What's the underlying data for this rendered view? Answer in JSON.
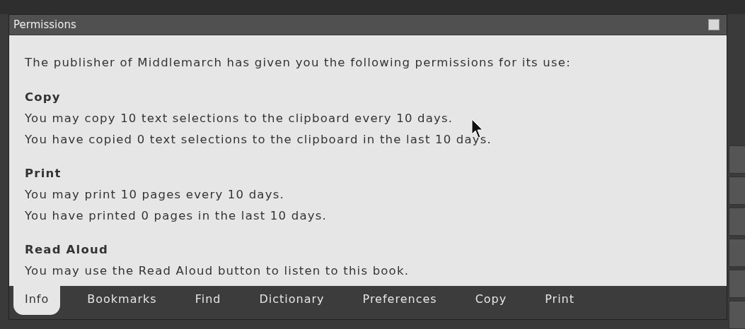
{
  "window": {
    "title": "Permissions"
  },
  "intro": "The publisher of Middlemarch has given you the following permissions for its use:",
  "sections": [
    {
      "heading": "Copy",
      "lines": [
        "You may copy 10 text selections to the clipboard every 10 days.",
        "You have copied 0 text selections to the clipboard in the last 10 days."
      ]
    },
    {
      "heading": "Print",
      "lines": [
        "You may print 10 pages every 10 days.",
        "You have printed 0 pages in the last 10 days."
      ]
    },
    {
      "heading": "Read Aloud",
      "lines": [
        "You may use the Read Aloud button to listen to this book."
      ]
    }
  ],
  "tabs": [
    {
      "label": "Info",
      "selected": true
    },
    {
      "label": "Bookmarks",
      "selected": false
    },
    {
      "label": "Find",
      "selected": false
    },
    {
      "label": "Dictionary",
      "selected": false
    },
    {
      "label": "Preferences",
      "selected": false
    },
    {
      "label": "Copy",
      "selected": false
    },
    {
      "label": "Print",
      "selected": false
    }
  ]
}
